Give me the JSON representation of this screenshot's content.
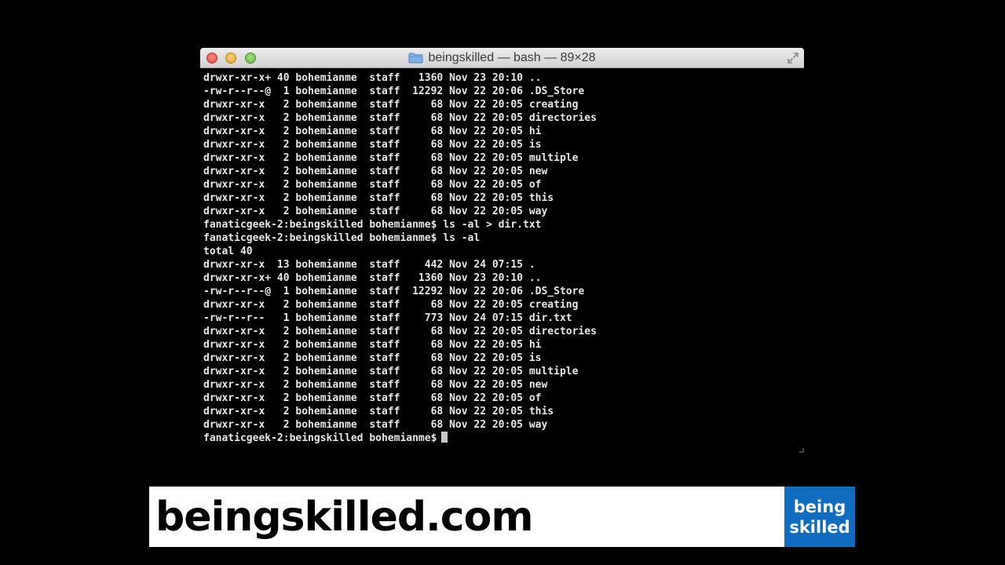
{
  "window": {
    "title": "beingskilled — bash — 89×28",
    "folder_icon": "folder-icon",
    "fullscreen_icon": "fullscreen-arrows-icon"
  },
  "terminal": {
    "lines": [
      "drwxr-xr-x+ 40 bohemianme  staff   1360 Nov 23 20:10 ..",
      "-rw-r--r--@  1 bohemianme  staff  12292 Nov 22 20:06 .DS_Store",
      "drwxr-xr-x   2 bohemianme  staff     68 Nov 22 20:05 creating",
      "drwxr-xr-x   2 bohemianme  staff     68 Nov 22 20:05 directories",
      "drwxr-xr-x   2 bohemianme  staff     68 Nov 22 20:05 hi",
      "drwxr-xr-x   2 bohemianme  staff     68 Nov 22 20:05 is",
      "drwxr-xr-x   2 bohemianme  staff     68 Nov 22 20:05 multiple",
      "drwxr-xr-x   2 bohemianme  staff     68 Nov 22 20:05 new",
      "drwxr-xr-x   2 bohemianme  staff     68 Nov 22 20:05 of",
      "drwxr-xr-x   2 bohemianme  staff     68 Nov 22 20:05 this",
      "drwxr-xr-x   2 bohemianme  staff     68 Nov 22 20:05 way",
      "fanaticgeek-2:beingskilled bohemianme$ ls -al > dir.txt",
      "fanaticgeek-2:beingskilled bohemianme$ ls -al",
      "total 40",
      "drwxr-xr-x  13 bohemianme  staff    442 Nov 24 07:15 .",
      "drwxr-xr-x+ 40 bohemianme  staff   1360 Nov 23 20:10 ..",
      "-rw-r--r--@  1 bohemianme  staff  12292 Nov 22 20:06 .DS_Store",
      "drwxr-xr-x   2 bohemianme  staff     68 Nov 22 20:05 creating",
      "-rw-r--r--   1 bohemianme  staff    773 Nov 24 07:15 dir.txt",
      "drwxr-xr-x   2 bohemianme  staff     68 Nov 22 20:05 directories",
      "drwxr-xr-x   2 bohemianme  staff     68 Nov 22 20:05 hi",
      "drwxr-xr-x   2 bohemianme  staff     68 Nov 22 20:05 is",
      "drwxr-xr-x   2 bohemianme  staff     68 Nov 22 20:05 multiple",
      "drwxr-xr-x   2 bohemianme  staff     68 Nov 22 20:05 new",
      "drwxr-xr-x   2 bohemianme  staff     68 Nov 22 20:05 of",
      "drwxr-xr-x   2 bohemianme  staff     68 Nov 22 20:05 this",
      "drwxr-xr-x   2 bohemianme  staff     68 Nov 22 20:05 way"
    ],
    "prompt": "fanaticgeek-2:beingskilled bohemianme$"
  },
  "banner": {
    "site_text": "beingskilled.com",
    "logo_line1": "being",
    "logo_line2": "skilled"
  },
  "colors": {
    "terminal_bg": "#000000",
    "terminal_text": "#e8e8e8",
    "logo_blue": "#0f6cbf"
  }
}
